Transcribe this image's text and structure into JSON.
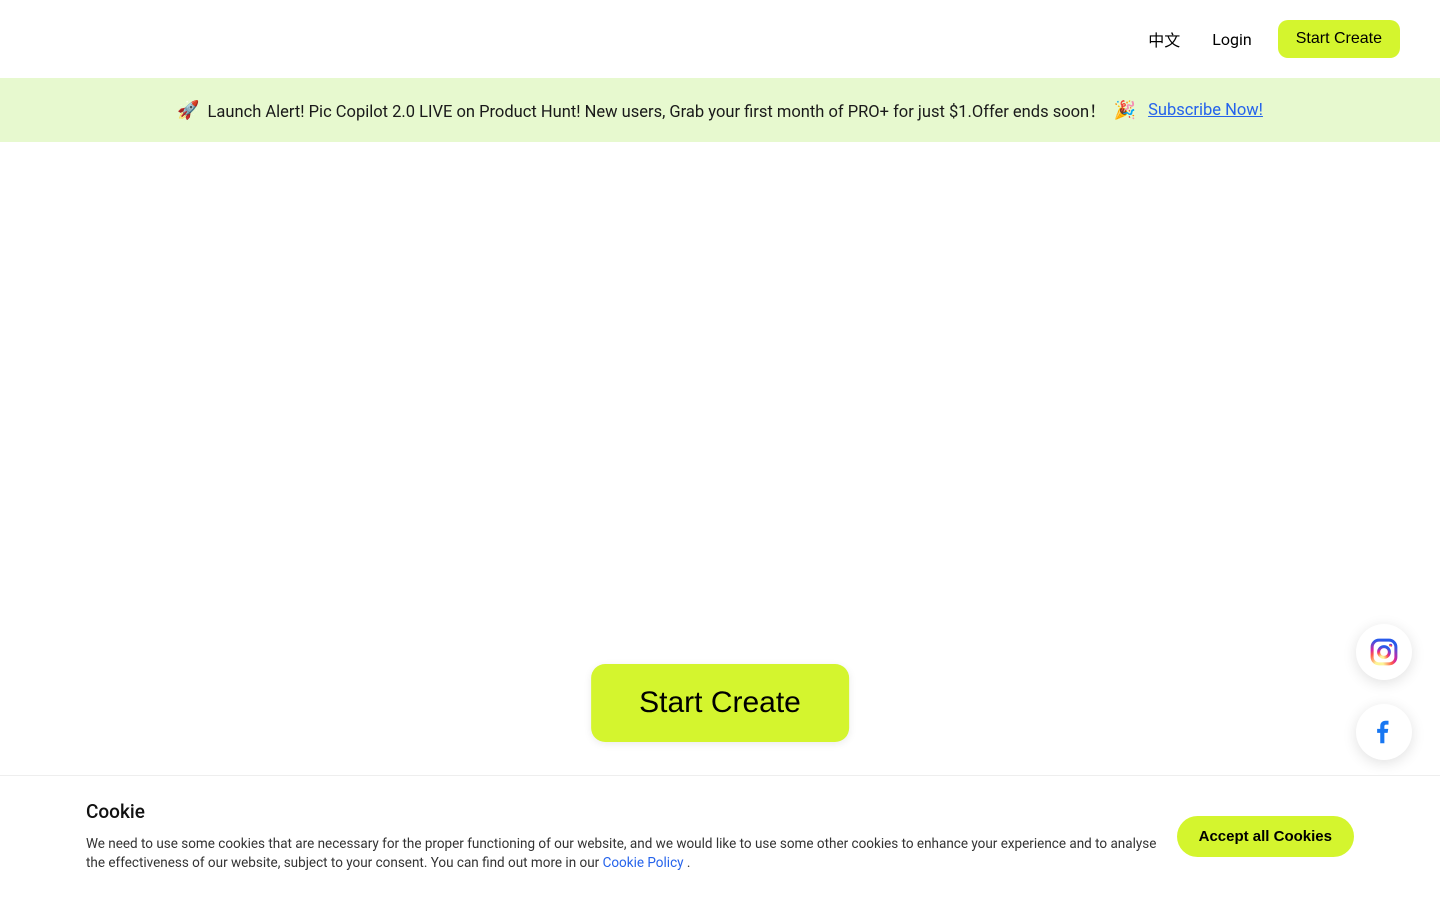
{
  "header": {
    "language_label": "中文",
    "login_label": "Login",
    "start_create_label": "Start Create"
  },
  "banner": {
    "rocket_emoji": "🚀",
    "text": "Launch Alert! Pic Copilot 2.0 LIVE on Product Hunt! New users, Grab your first month of PRO+ for just $1.Offer ends soon！",
    "confetti_emoji": "🎉",
    "subscribe_label": "Subscribe Now!"
  },
  "cta": {
    "label": "Start Create"
  },
  "social": {
    "instagram_icon": "instagram-icon",
    "facebook_icon": "facebook-icon"
  },
  "cookie": {
    "title": "Cookie",
    "description_part1": "We need to use some cookies that are necessary for the proper functioning of our website, and we would like to use some other cookies to enhance your experience and to analyse the effectiveness of our website, subject to your consent. You can find out more in our ",
    "policy_link_label": "Cookie Policy",
    "description_part2": " .",
    "accept_label": "Accept all Cookies"
  }
}
